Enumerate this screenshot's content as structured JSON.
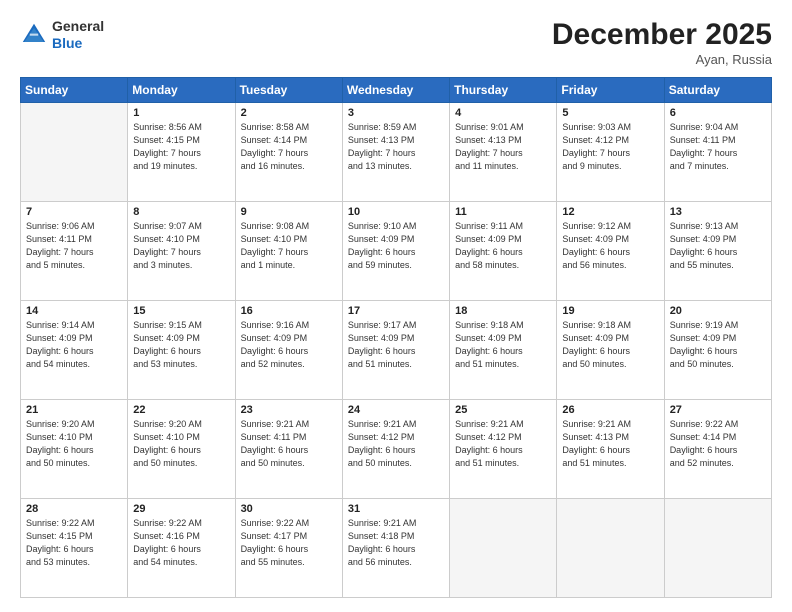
{
  "header": {
    "logo_line1": "General",
    "logo_line2": "Blue",
    "month": "December 2025",
    "location": "Ayan, Russia"
  },
  "days_of_week": [
    "Sunday",
    "Monday",
    "Tuesday",
    "Wednesday",
    "Thursday",
    "Friday",
    "Saturday"
  ],
  "weeks": [
    [
      {
        "day": "",
        "info": ""
      },
      {
        "day": "1",
        "info": "Sunrise: 8:56 AM\nSunset: 4:15 PM\nDaylight: 7 hours\nand 19 minutes."
      },
      {
        "day": "2",
        "info": "Sunrise: 8:58 AM\nSunset: 4:14 PM\nDaylight: 7 hours\nand 16 minutes."
      },
      {
        "day": "3",
        "info": "Sunrise: 8:59 AM\nSunset: 4:13 PM\nDaylight: 7 hours\nand 13 minutes."
      },
      {
        "day": "4",
        "info": "Sunrise: 9:01 AM\nSunset: 4:13 PM\nDaylight: 7 hours\nand 11 minutes."
      },
      {
        "day": "5",
        "info": "Sunrise: 9:03 AM\nSunset: 4:12 PM\nDaylight: 7 hours\nand 9 minutes."
      },
      {
        "day": "6",
        "info": "Sunrise: 9:04 AM\nSunset: 4:11 PM\nDaylight: 7 hours\nand 7 minutes."
      }
    ],
    [
      {
        "day": "7",
        "info": "Sunrise: 9:06 AM\nSunset: 4:11 PM\nDaylight: 7 hours\nand 5 minutes."
      },
      {
        "day": "8",
        "info": "Sunrise: 9:07 AM\nSunset: 4:10 PM\nDaylight: 7 hours\nand 3 minutes."
      },
      {
        "day": "9",
        "info": "Sunrise: 9:08 AM\nSunset: 4:10 PM\nDaylight: 7 hours\nand 1 minute."
      },
      {
        "day": "10",
        "info": "Sunrise: 9:10 AM\nSunset: 4:09 PM\nDaylight: 6 hours\nand 59 minutes."
      },
      {
        "day": "11",
        "info": "Sunrise: 9:11 AM\nSunset: 4:09 PM\nDaylight: 6 hours\nand 58 minutes."
      },
      {
        "day": "12",
        "info": "Sunrise: 9:12 AM\nSunset: 4:09 PM\nDaylight: 6 hours\nand 56 minutes."
      },
      {
        "day": "13",
        "info": "Sunrise: 9:13 AM\nSunset: 4:09 PM\nDaylight: 6 hours\nand 55 minutes."
      }
    ],
    [
      {
        "day": "14",
        "info": "Sunrise: 9:14 AM\nSunset: 4:09 PM\nDaylight: 6 hours\nand 54 minutes."
      },
      {
        "day": "15",
        "info": "Sunrise: 9:15 AM\nSunset: 4:09 PM\nDaylight: 6 hours\nand 53 minutes."
      },
      {
        "day": "16",
        "info": "Sunrise: 9:16 AM\nSunset: 4:09 PM\nDaylight: 6 hours\nand 52 minutes."
      },
      {
        "day": "17",
        "info": "Sunrise: 9:17 AM\nSunset: 4:09 PM\nDaylight: 6 hours\nand 51 minutes."
      },
      {
        "day": "18",
        "info": "Sunrise: 9:18 AM\nSunset: 4:09 PM\nDaylight: 6 hours\nand 51 minutes."
      },
      {
        "day": "19",
        "info": "Sunrise: 9:18 AM\nSunset: 4:09 PM\nDaylight: 6 hours\nand 50 minutes."
      },
      {
        "day": "20",
        "info": "Sunrise: 9:19 AM\nSunset: 4:09 PM\nDaylight: 6 hours\nand 50 minutes."
      }
    ],
    [
      {
        "day": "21",
        "info": "Sunrise: 9:20 AM\nSunset: 4:10 PM\nDaylight: 6 hours\nand 50 minutes."
      },
      {
        "day": "22",
        "info": "Sunrise: 9:20 AM\nSunset: 4:10 PM\nDaylight: 6 hours\nand 50 minutes."
      },
      {
        "day": "23",
        "info": "Sunrise: 9:21 AM\nSunset: 4:11 PM\nDaylight: 6 hours\nand 50 minutes."
      },
      {
        "day": "24",
        "info": "Sunrise: 9:21 AM\nSunset: 4:12 PM\nDaylight: 6 hours\nand 50 minutes."
      },
      {
        "day": "25",
        "info": "Sunrise: 9:21 AM\nSunset: 4:12 PM\nDaylight: 6 hours\nand 51 minutes."
      },
      {
        "day": "26",
        "info": "Sunrise: 9:21 AM\nSunset: 4:13 PM\nDaylight: 6 hours\nand 51 minutes."
      },
      {
        "day": "27",
        "info": "Sunrise: 9:22 AM\nSunset: 4:14 PM\nDaylight: 6 hours\nand 52 minutes."
      }
    ],
    [
      {
        "day": "28",
        "info": "Sunrise: 9:22 AM\nSunset: 4:15 PM\nDaylight: 6 hours\nand 53 minutes."
      },
      {
        "day": "29",
        "info": "Sunrise: 9:22 AM\nSunset: 4:16 PM\nDaylight: 6 hours\nand 54 minutes."
      },
      {
        "day": "30",
        "info": "Sunrise: 9:22 AM\nSunset: 4:17 PM\nDaylight: 6 hours\nand 55 minutes."
      },
      {
        "day": "31",
        "info": "Sunrise: 9:21 AM\nSunset: 4:18 PM\nDaylight: 6 hours\nand 56 minutes."
      },
      {
        "day": "",
        "info": ""
      },
      {
        "day": "",
        "info": ""
      },
      {
        "day": "",
        "info": ""
      }
    ]
  ]
}
